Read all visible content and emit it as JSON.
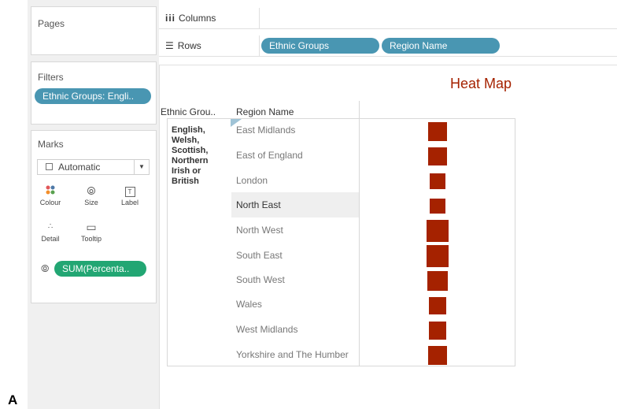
{
  "left_panel": {
    "pages_title": "Pages",
    "filters_title": "Filters",
    "filter_pill": "Ethnic Groups: Engli..",
    "marks_title": "Marks",
    "mark_type": "Automatic",
    "mark_buttons": {
      "colour": "Colour",
      "size": "Size",
      "label": "Label",
      "detail": "Detail",
      "tooltip": "Tooltip"
    },
    "size_pill": "SUM(Percenta.."
  },
  "shelves": {
    "columns_label": "Columns",
    "rows_label": "Rows",
    "rows_pills": [
      "Ethnic Groups",
      "Region Name"
    ]
  },
  "view": {
    "title": "Heat Map",
    "header_ethnic": "Ethnic Grou..",
    "header_region": "Region Name",
    "ethnic_group": "English,\nWelsh,\nScottish,\nNorthern\nIrish or\nBritish",
    "highlighted_row": "North East"
  },
  "figure_letter": "A",
  "colors": {
    "accent_blue": "#4996b2",
    "accent_green": "#22a673",
    "mark_color": "#a52200"
  },
  "chart_data": {
    "type": "heatmap",
    "title": "Heat Map",
    "categories": [
      "East Midlands",
      "East of England",
      "London",
      "North East",
      "North West",
      "South East",
      "South West",
      "Wales",
      "West Midlands",
      "Yorkshire and The Humber"
    ],
    "relative_size": [
      0.85,
      0.85,
      0.7,
      0.7,
      1.0,
      1.0,
      0.9,
      0.8,
      0.8,
      0.85
    ],
    "mark_shape": "square",
    "mark_color": "#a52200"
  }
}
